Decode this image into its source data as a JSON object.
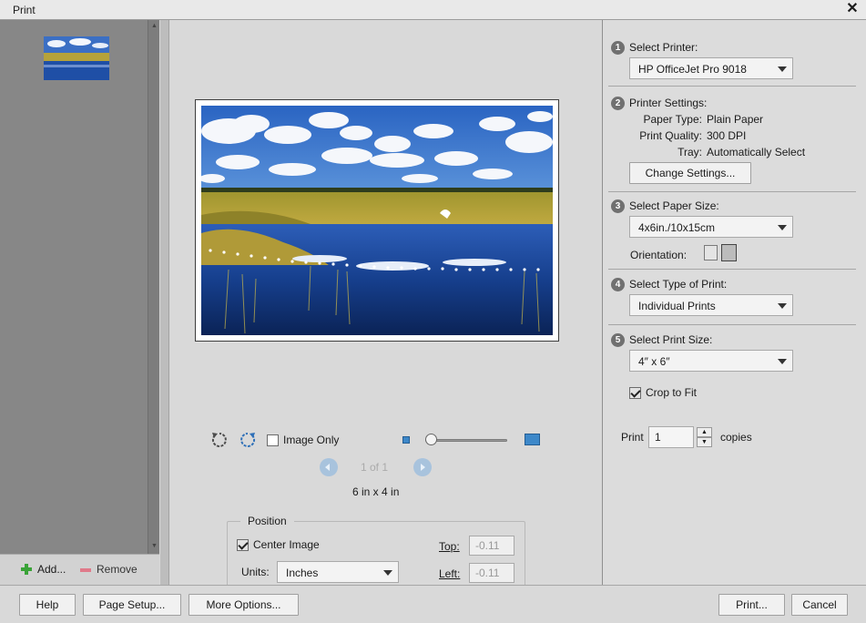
{
  "window": {
    "title": "Print"
  },
  "left_panel": {
    "add_label": "Add...",
    "remove_label": "Remove"
  },
  "preview": {
    "image_only_label": "Image Only",
    "page_indicator": "1 of 1",
    "size_label": "6 in x 4 in"
  },
  "position": {
    "legend": "Position",
    "center_image_label": "Center Image",
    "units_label": "Units:",
    "units_value": "Inches",
    "top_label": "Top:",
    "top_value": "-0.11",
    "left_label": "Left:",
    "left_value": "-0.11"
  },
  "right_panel": {
    "step1": {
      "num": "1",
      "label": "Select Printer:",
      "value": "HP OfficeJet Pro 9018"
    },
    "step2": {
      "num": "2",
      "label": "Printer Settings:",
      "paper_type_label": "Paper Type:",
      "paper_type_value": "Plain Paper",
      "print_quality_label": "Print Quality:",
      "print_quality_value": "300 DPI",
      "tray_label": "Tray:",
      "tray_value": "Automatically Select",
      "change_settings_label": "Change Settings..."
    },
    "step3": {
      "num": "3",
      "label": "Select Paper Size:",
      "value": "4x6in./10x15cm",
      "orientation_label": "Orientation:"
    },
    "step4": {
      "num": "4",
      "label": "Select Type of Print:",
      "value": "Individual Prints"
    },
    "step5": {
      "num": "5",
      "label": "Select Print Size:",
      "value": "4″ x 6″",
      "crop_label": "Crop to Fit"
    },
    "copies": {
      "print_label": "Print",
      "value": "1",
      "copies_label": "copies"
    }
  },
  "bottom": {
    "help_label": "Help",
    "page_setup_label": "Page Setup...",
    "more_options_label": "More Options...",
    "print_label": "Print...",
    "cancel_label": "Cancel"
  },
  "colors": {
    "accent": "#3aa338",
    "remove": "#e07a8a",
    "nav": "#a8c3dd"
  },
  "state": {
    "image_only": false,
    "center_image": true,
    "crop_to_fit": true,
    "orientation": "landscape"
  }
}
